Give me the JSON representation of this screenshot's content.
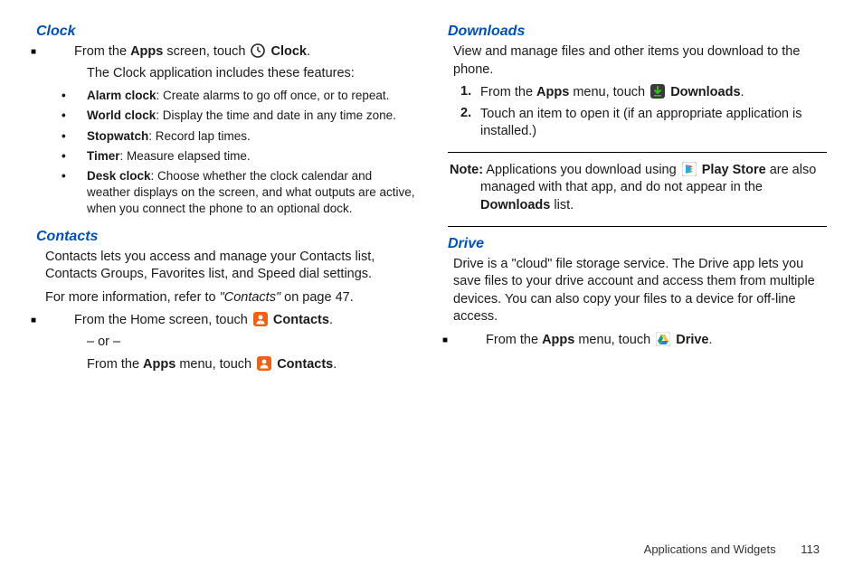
{
  "left": {
    "clock": {
      "heading": "Clock",
      "line1_pre": "From the ",
      "line1_apps": "Apps",
      "line1_mid": " screen, touch ",
      "line1_post": " ",
      "line1_clock": "Clock",
      "line1_end": ".",
      "line2": "The Clock application includes these features:",
      "f1_b": "Alarm clock",
      "f1_t": ": Create alarms to go off once, or to repeat.",
      "f2_b": "World clock",
      "f2_t": ": Display the time and date in any time zone.",
      "f3_b": "Stopwatch",
      "f3_t": ": Record lap times.",
      "f4_b": "Timer",
      "f4_t": ": Measure elapsed time.",
      "f5_b": "Desk clock",
      "f5_t": ": Choose whether the clock calendar and weather displays on the screen, and what outputs are active, when you connect the phone to an optional dock."
    },
    "contacts": {
      "heading": "Contacts",
      "p1": "Contacts lets you access and manage your Contacts list, Contacts Groups, Favorites list, and Speed dial settings.",
      "p2_pre": "For more information, refer to ",
      "p2_ref": "\"Contacts\"",
      "p2_post": " on page 47.",
      "l1_pre": "From the Home screen, touch ",
      "l1_b": "Contacts",
      "l1_end": ".",
      "or": "– or –",
      "l2_pre": "From the ",
      "l2_apps": "Apps",
      "l2_mid": " menu, touch ",
      "l2_b": "Contacts",
      "l2_end": "."
    }
  },
  "right": {
    "downloads": {
      "heading": "Downloads",
      "p1": "View and manage files and other items you download to the phone.",
      "n1_pre": "From the ",
      "n1_apps": "Apps",
      "n1_mid": " menu, touch ",
      "n1_b": "Downloads",
      "n1_end": ".",
      "n2": "Touch an item to open it (if an appropriate application is installed.)",
      "note_label": "Note:",
      "note_pre": " Applications you download using ",
      "note_play": "Play Store",
      "note_mid": " are also managed with that app, and do not appear in the ",
      "note_dl": "Downloads",
      "note_end": " list."
    },
    "drive": {
      "heading": "Drive",
      "p1": "Drive is a \"cloud\" file storage service. The Drive app lets you save files to your drive account and access them from multiple devices. You can also copy your files to a device for off-line access.",
      "l1_pre": "From the ",
      "l1_apps": "Apps",
      "l1_mid": " menu, touch ",
      "l1_b": "Drive",
      "l1_end": "."
    }
  },
  "footer": {
    "section": "Applications and Widgets",
    "page": "113"
  }
}
